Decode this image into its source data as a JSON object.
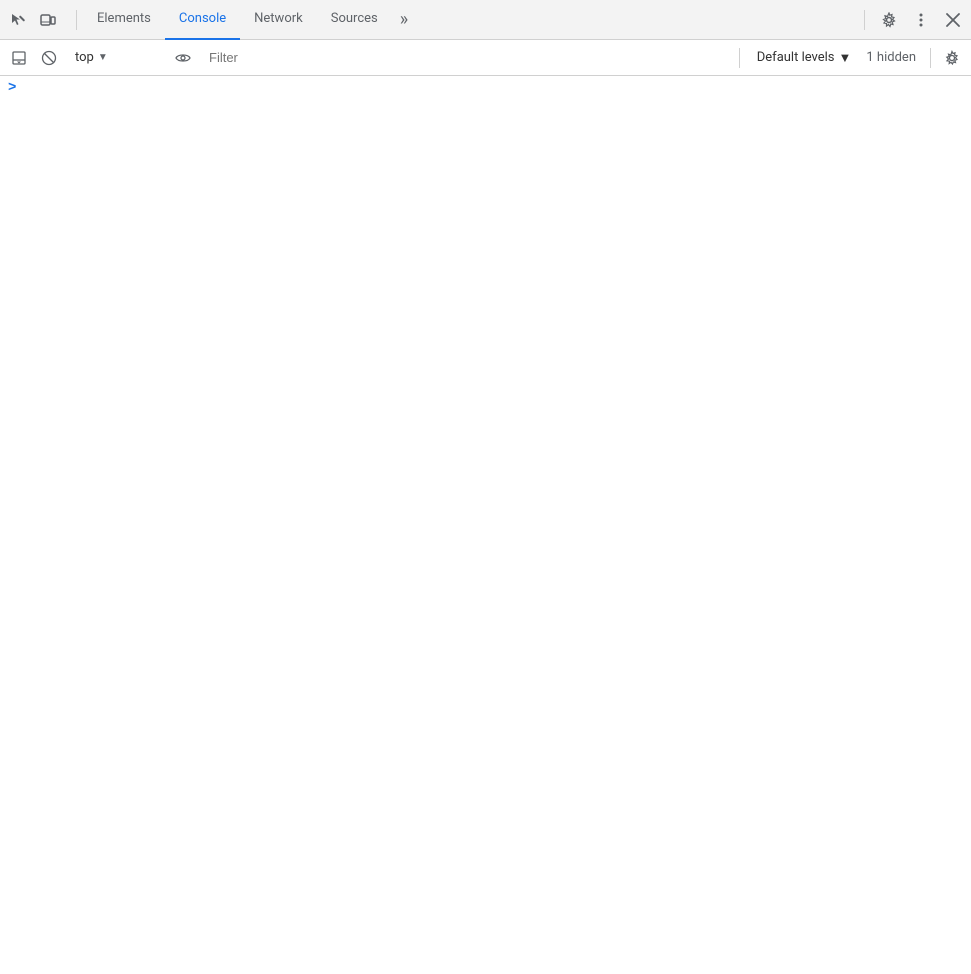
{
  "tabs": {
    "items": [
      {
        "id": "elements",
        "label": "Elements",
        "active": false
      },
      {
        "id": "console",
        "label": "Console",
        "active": true
      },
      {
        "id": "network",
        "label": "Network",
        "active": false
      },
      {
        "id": "sources",
        "label": "Sources",
        "active": false
      }
    ],
    "more_label": "»"
  },
  "toolbar": {
    "context_label": "top",
    "context_arrow": "▼",
    "filter_placeholder": "Filter",
    "levels_label": "Default levels",
    "levels_arrow": "▼",
    "hidden_label": "1 hidden"
  },
  "console": {
    "prompt_arrow": ">"
  },
  "icons": {
    "inspect": "⬡",
    "device": "⬜",
    "clear": "🚫",
    "eye": "👁",
    "gear": "⚙",
    "dots": "⋮",
    "close": "✕",
    "settings_gear": "⚙"
  },
  "colors": {
    "active_tab": "#1a73e8",
    "border": "#d0d0d0",
    "icon": "#5f6368"
  }
}
